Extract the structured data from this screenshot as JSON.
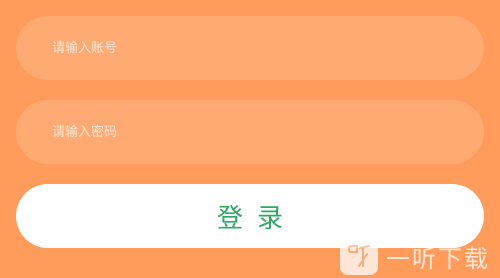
{
  "login_form": {
    "account": {
      "placeholder": "请输入账号",
      "value": ""
    },
    "password": {
      "placeholder": "请输入密码",
      "value": ""
    },
    "login_button_label": "登录"
  },
  "watermark": {
    "text": "一听下载",
    "logo_icon": "listen-logo-icon"
  },
  "colors": {
    "background": "#FF9C5B",
    "field_background": "#FFAA73",
    "placeholder": "#FFE6D3",
    "button_background": "#FFFFFF",
    "button_text": "#2FA866"
  }
}
